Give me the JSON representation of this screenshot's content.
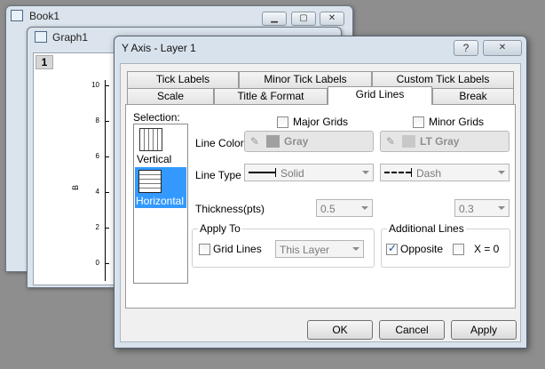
{
  "book_window": {
    "title": "Book1"
  },
  "graph_window": {
    "title": "Graph1",
    "layer_index": "1",
    "axis_label": "B",
    "y_ticks": [
      "10",
      "8",
      "6",
      "4",
      "2",
      "0"
    ]
  },
  "dialog": {
    "title": "Y Axis - Layer 1",
    "help_glyph": "?",
    "close_glyph": "✕",
    "tabs_row1": [
      "Tick Labels",
      "Minor Tick Labels",
      "Custom Tick Labels"
    ],
    "tabs_row2": [
      "Scale",
      "Title & Format",
      "Grid Lines",
      "Break"
    ],
    "active_tab": "Grid Lines",
    "selection": {
      "label": "Selection:",
      "items": [
        {
          "label": "Vertical",
          "selected": false
        },
        {
          "label": "Horizontal",
          "selected": true
        }
      ]
    },
    "major": {
      "header": "Major Grids",
      "checked": false,
      "color": "Gray",
      "line_type": "Solid",
      "thickness": "0.5"
    },
    "minor": {
      "header": "Minor Grids",
      "checked": false,
      "color": "LT Gray",
      "line_type": "Dash",
      "thickness": "0.3"
    },
    "row_labels": {
      "color": "Line Color",
      "type": "Line Type",
      "thickness": "Thickness(pts)"
    },
    "apply_to": {
      "title": "Apply To",
      "grid_lines_label": "Grid Lines",
      "grid_lines_checked": false,
      "scope_value": "This Layer"
    },
    "additional": {
      "title": "Additional Lines",
      "opposite_label": "Opposite",
      "opposite_checked": true,
      "x0_label": "X = 0",
      "x0_checked": false
    },
    "buttons": {
      "ok": "OK",
      "cancel": "Cancel",
      "apply": "Apply"
    }
  },
  "colors": {
    "selection_highlight": "#3399ff",
    "desktop": "#8e8e8e",
    "frame": "#d8e2ec",
    "gray_swatch": "#a0a0a0",
    "ltgray_swatch": "#c8c8c8"
  }
}
